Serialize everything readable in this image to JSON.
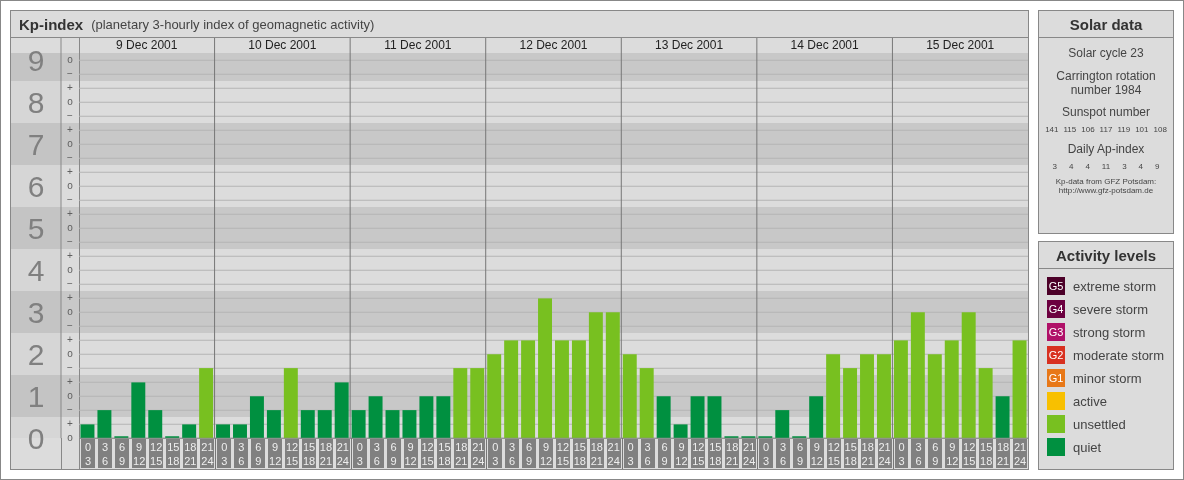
{
  "header": {
    "title": "Kp-index",
    "subtitle": "(planetary 3-hourly index of geomagnetic activity)"
  },
  "chart": {
    "y_minor_labels": [
      "o",
      "−",
      "+",
      "o",
      "−",
      "+",
      "o",
      "−",
      "+",
      "o",
      "−",
      "+",
      "o",
      "−",
      "+",
      "o",
      "−",
      "+",
      "o",
      "−",
      "+",
      "o",
      "−",
      "+",
      "o",
      "−",
      "+",
      "o"
    ],
    "days": [
      "9 Dec 2001",
      "10 Dec 2001",
      "11 Dec 2001",
      "12 Dec 2001",
      "13 Dec 2001",
      "14 Dec 2001",
      "15 Dec 2001"
    ],
    "chart_data": {
      "type": "bar",
      "grid": true,
      "ylim": [
        0,
        9.53
      ],
      "categories": [
        "0 3",
        "3 6",
        "6 9",
        "9 12",
        "12 15",
        "15 18",
        "18 21",
        "21 24",
        "0 3",
        "3 6",
        "6 9",
        "9 12",
        "12 15",
        "15 18",
        "18 21",
        "21 24",
        "0 3",
        "3 6",
        "6 9",
        "9 12",
        "12 15",
        "15 18",
        "18 21",
        "21 24",
        "0 3",
        "3 6",
        "6 9",
        "9 12",
        "12 15",
        "15 18",
        "18 21",
        "21 24",
        "0 3",
        "3 6",
        "6 9",
        "9 12",
        "12 15",
        "15 18",
        "18 21",
        "21 24",
        "0 3",
        "3 6",
        "6 9",
        "9 12",
        "12 15",
        "15 18",
        "18 21",
        "21 24",
        "0 3",
        "3 6",
        "6 9",
        "9 12",
        "12 15",
        "15 18",
        "18 21",
        "21 24"
      ],
      "yticks": [
        {
          "value": 0,
          "label": "0"
        },
        {
          "value": 1,
          "label": "1"
        },
        {
          "value": 2,
          "label": "2"
        },
        {
          "value": 3,
          "label": "3"
        },
        {
          "value": 4,
          "label": "4"
        },
        {
          "value": 5,
          "label": "5"
        },
        {
          "value": 6,
          "label": "6"
        },
        {
          "value": 7,
          "label": "7"
        },
        {
          "value": 8,
          "label": "8"
        },
        {
          "value": 9,
          "label": "9"
        }
      ],
      "series": [
        {
          "color": "#009040",
          "values": [
            0.33,
            0.67,
            0,
            1.33,
            0.67,
            0,
            0.33,
            null,
            0.33,
            0.33,
            1,
            0.67,
            null,
            0.67,
            0.67,
            1.33,
            0.67,
            1,
            0.67,
            0.67,
            1,
            1,
            null,
            null,
            null,
            null,
            null,
            null,
            null,
            null,
            null,
            null,
            null,
            null,
            1,
            0.33,
            1,
            1,
            0,
            0,
            0,
            0.67,
            0,
            1,
            null,
            null,
            null,
            null,
            null,
            null,
            null,
            null,
            null,
            null,
            1,
            null
          ]
        },
        {
          "color": "#78c020",
          "values": [
            null,
            null,
            null,
            null,
            null,
            null,
            null,
            1.67,
            null,
            null,
            null,
            null,
            1.67,
            null,
            null,
            null,
            null,
            null,
            null,
            null,
            null,
            null,
            1.67,
            1.67,
            2,
            2.33,
            2.33,
            3.33,
            2.33,
            2.33,
            3,
            3,
            2,
            1.67,
            null,
            null,
            null,
            null,
            null,
            null,
            null,
            null,
            null,
            null,
            2,
            1.67,
            2,
            2,
            2.33,
            3,
            2,
            2.33,
            3,
            1.67,
            null,
            2.33
          ]
        }
      ]
    }
  },
  "solar": {
    "title": "Solar data",
    "cycle": "Solar cycle 23",
    "rotation": "Carrington rotation number 1984",
    "sunspot_label": "Sunspot number",
    "sunspot_numbers": [
      "141",
      "115",
      "106",
      "117",
      "119",
      "101",
      "108"
    ],
    "ap_label": "Daily Ap-index",
    "ap_values": [
      "3",
      "4",
      "4",
      "11",
      "3",
      "4",
      "9"
    ],
    "credit": [
      "Kp-data from GFZ Potsdam:",
      "http://www.gfz-potsdam.de"
    ]
  },
  "legend": {
    "title": "Activity levels",
    "items": [
      {
        "badge": "G5",
        "label": "extreme storm",
        "color": "#4c0028"
      },
      {
        "badge": "G4",
        "label": "severe storm",
        "color": "#6c0040"
      },
      {
        "badge": "G3",
        "label": "strong storm",
        "color": "#b01068"
      },
      {
        "badge": "G2",
        "label": "moderate storm",
        "color": "#d83020"
      },
      {
        "badge": "G1",
        "label": "minor storm",
        "color": "#e87818"
      },
      {
        "label": "active",
        "color": "#f8c000"
      },
      {
        "label": "unsettled",
        "color": "#78c020"
      },
      {
        "label": "quiet",
        "color": "#009040"
      }
    ]
  }
}
